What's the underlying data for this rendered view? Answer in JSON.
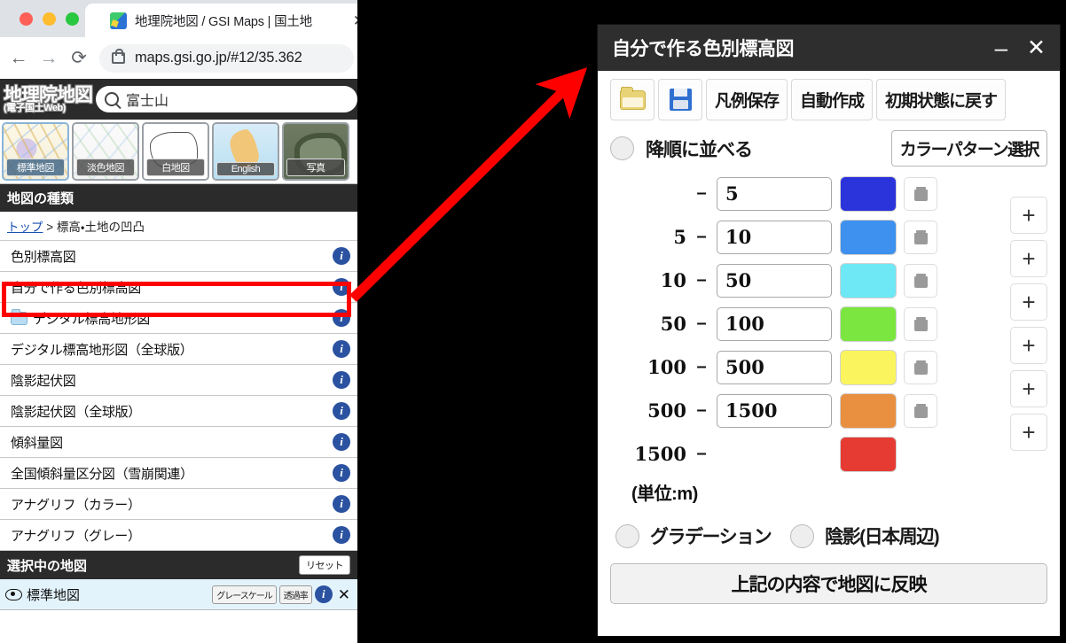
{
  "browser": {
    "tab": {
      "title": "地理院地図 / GSI Maps | 国土地",
      "close_label": "✕",
      "favicon": "gsi-favicon"
    },
    "nav": {
      "back": "←",
      "forward": "→",
      "reload": "⟳"
    },
    "omnibox": {
      "url": "maps.gsi.go.jp/#12/35.362",
      "lock": "lock-icon"
    }
  },
  "gsi": {
    "logo_line1": "地理院地図",
    "logo_line2": "(電子国土Web)",
    "search": {
      "value": "富士山",
      "icon": "search-icon"
    },
    "thumbnails": [
      {
        "label": "標準地図",
        "selected": true
      },
      {
        "label": "淡色地図",
        "selected": false
      },
      {
        "label": "白地図",
        "selected": false
      },
      {
        "label": "English",
        "selected": false
      },
      {
        "label": "写真",
        "selected": false
      }
    ],
    "map_types_header": "地図の種類",
    "breadcrumb": {
      "root": "トップ",
      "sep": " > ",
      "current": "標高・土地の凹凸"
    },
    "menu_items": [
      {
        "label": "色別標高図",
        "folder": false,
        "highlighted": false
      },
      {
        "label": "自分で作る色別標高図",
        "folder": false,
        "highlighted": true
      },
      {
        "label": "デジタル標高地形図",
        "folder": true,
        "highlighted": false
      },
      {
        "label": "デジタル標高地形図（全球版）",
        "folder": false,
        "highlighted": false
      },
      {
        "label": "陰影起伏図",
        "folder": false,
        "highlighted": false
      },
      {
        "label": "陰影起伏図（全球版）",
        "folder": false,
        "highlighted": false
      },
      {
        "label": "傾斜量図",
        "folder": false,
        "highlighted": false
      },
      {
        "label": "全国傾斜量区分図（雪崩関連）",
        "folder": false,
        "highlighted": false
      },
      {
        "label": "アナグリフ（カラー）",
        "folder": false,
        "highlighted": false
      },
      {
        "label": "アナグリフ（グレー）",
        "folder": false,
        "highlighted": false
      }
    ],
    "selected_header": "選択中の地図",
    "reset_label": "リセット",
    "selected_map": {
      "name": "標準地図",
      "grayscale_label": "グレースケール",
      "opacity_label": "透過率",
      "info_label": "i",
      "close_label": "✕"
    }
  },
  "dialog": {
    "title": "自分で作る色別標高図",
    "minimize_label": "–",
    "close_label": "✕",
    "toolbar": [
      {
        "type": "icon",
        "name": "open-folder-icon"
      },
      {
        "type": "icon",
        "name": "save-disk-icon"
      },
      {
        "type": "text",
        "label": "凡例保存"
      },
      {
        "type": "text",
        "label": "自動作成"
      },
      {
        "type": "text",
        "label": "初期状態に戻す"
      }
    ],
    "sort_option": {
      "label": "降順に並べる",
      "checked": false
    },
    "color_pattern_select": "カラーパターン選択",
    "unit_note": "(単位:m)",
    "delete_label": "trash-icon",
    "add_label": "+",
    "legend_rows": [
      {
        "from": "",
        "dash": "–",
        "to": "5",
        "color": "#2b33db",
        "deletable": true
      },
      {
        "from": "5",
        "dash": "–",
        "to": "10",
        "color": "#3e91ee",
        "deletable": true
      },
      {
        "from": "10",
        "dash": "–",
        "to": "50",
        "color": "#6ee8f5",
        "deletable": true
      },
      {
        "from": "50",
        "dash": "–",
        "to": "100",
        "color": "#7ae63f",
        "deletable": true
      },
      {
        "from": "100",
        "dash": "–",
        "to": "500",
        "color": "#faf55e",
        "deletable": true
      },
      {
        "from": "500",
        "dash": "–",
        "to": "1500",
        "color": "#e8903f",
        "deletable": true
      },
      {
        "from": "1500",
        "dash": "–",
        "to": null,
        "color": "#e63b33",
        "deletable": false
      }
    ],
    "gradation_option": {
      "label": "グラデーション",
      "checked": false
    },
    "shadow_option": {
      "label": "陰影(日本周辺)",
      "checked": false
    },
    "apply_button": "上記の内容で地図に反映"
  },
  "annotation": {
    "arrow_color": "#ff0000",
    "highlight_color": "#ff0000",
    "highlight_target": "自分で作る色別標高図"
  }
}
